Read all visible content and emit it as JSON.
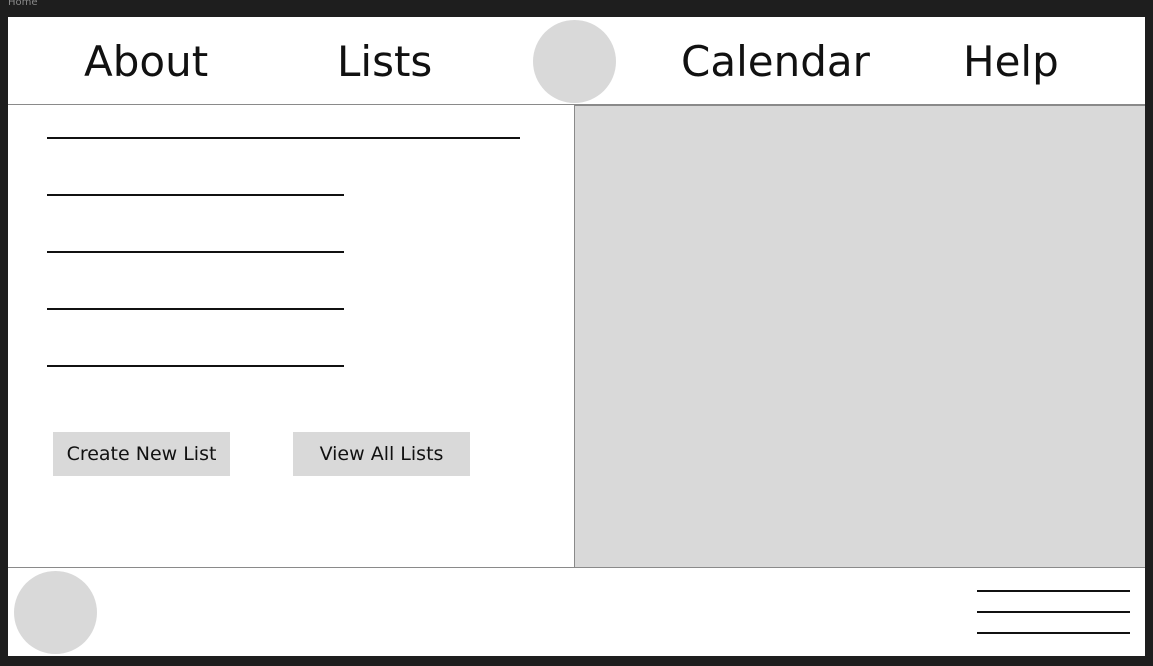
{
  "frame": {
    "label": "Home"
  },
  "header": {
    "nav": {
      "about": "About",
      "lists": "Lists",
      "calendar": "Calendar",
      "help": "Help"
    },
    "logo": "circle-logo-icon"
  },
  "main": {
    "buttons": {
      "create_new_list": "Create New List",
      "view_all_lists": "View All Lists"
    }
  },
  "footer": {
    "avatar": "circle-avatar-icon",
    "menu": "hamburger-menu-icon"
  },
  "colors": {
    "background": "#1e1e1e",
    "frame": "#ffffff",
    "placeholder": "#d9d9d9",
    "border": "#8a8a8a",
    "text": "#111111"
  }
}
